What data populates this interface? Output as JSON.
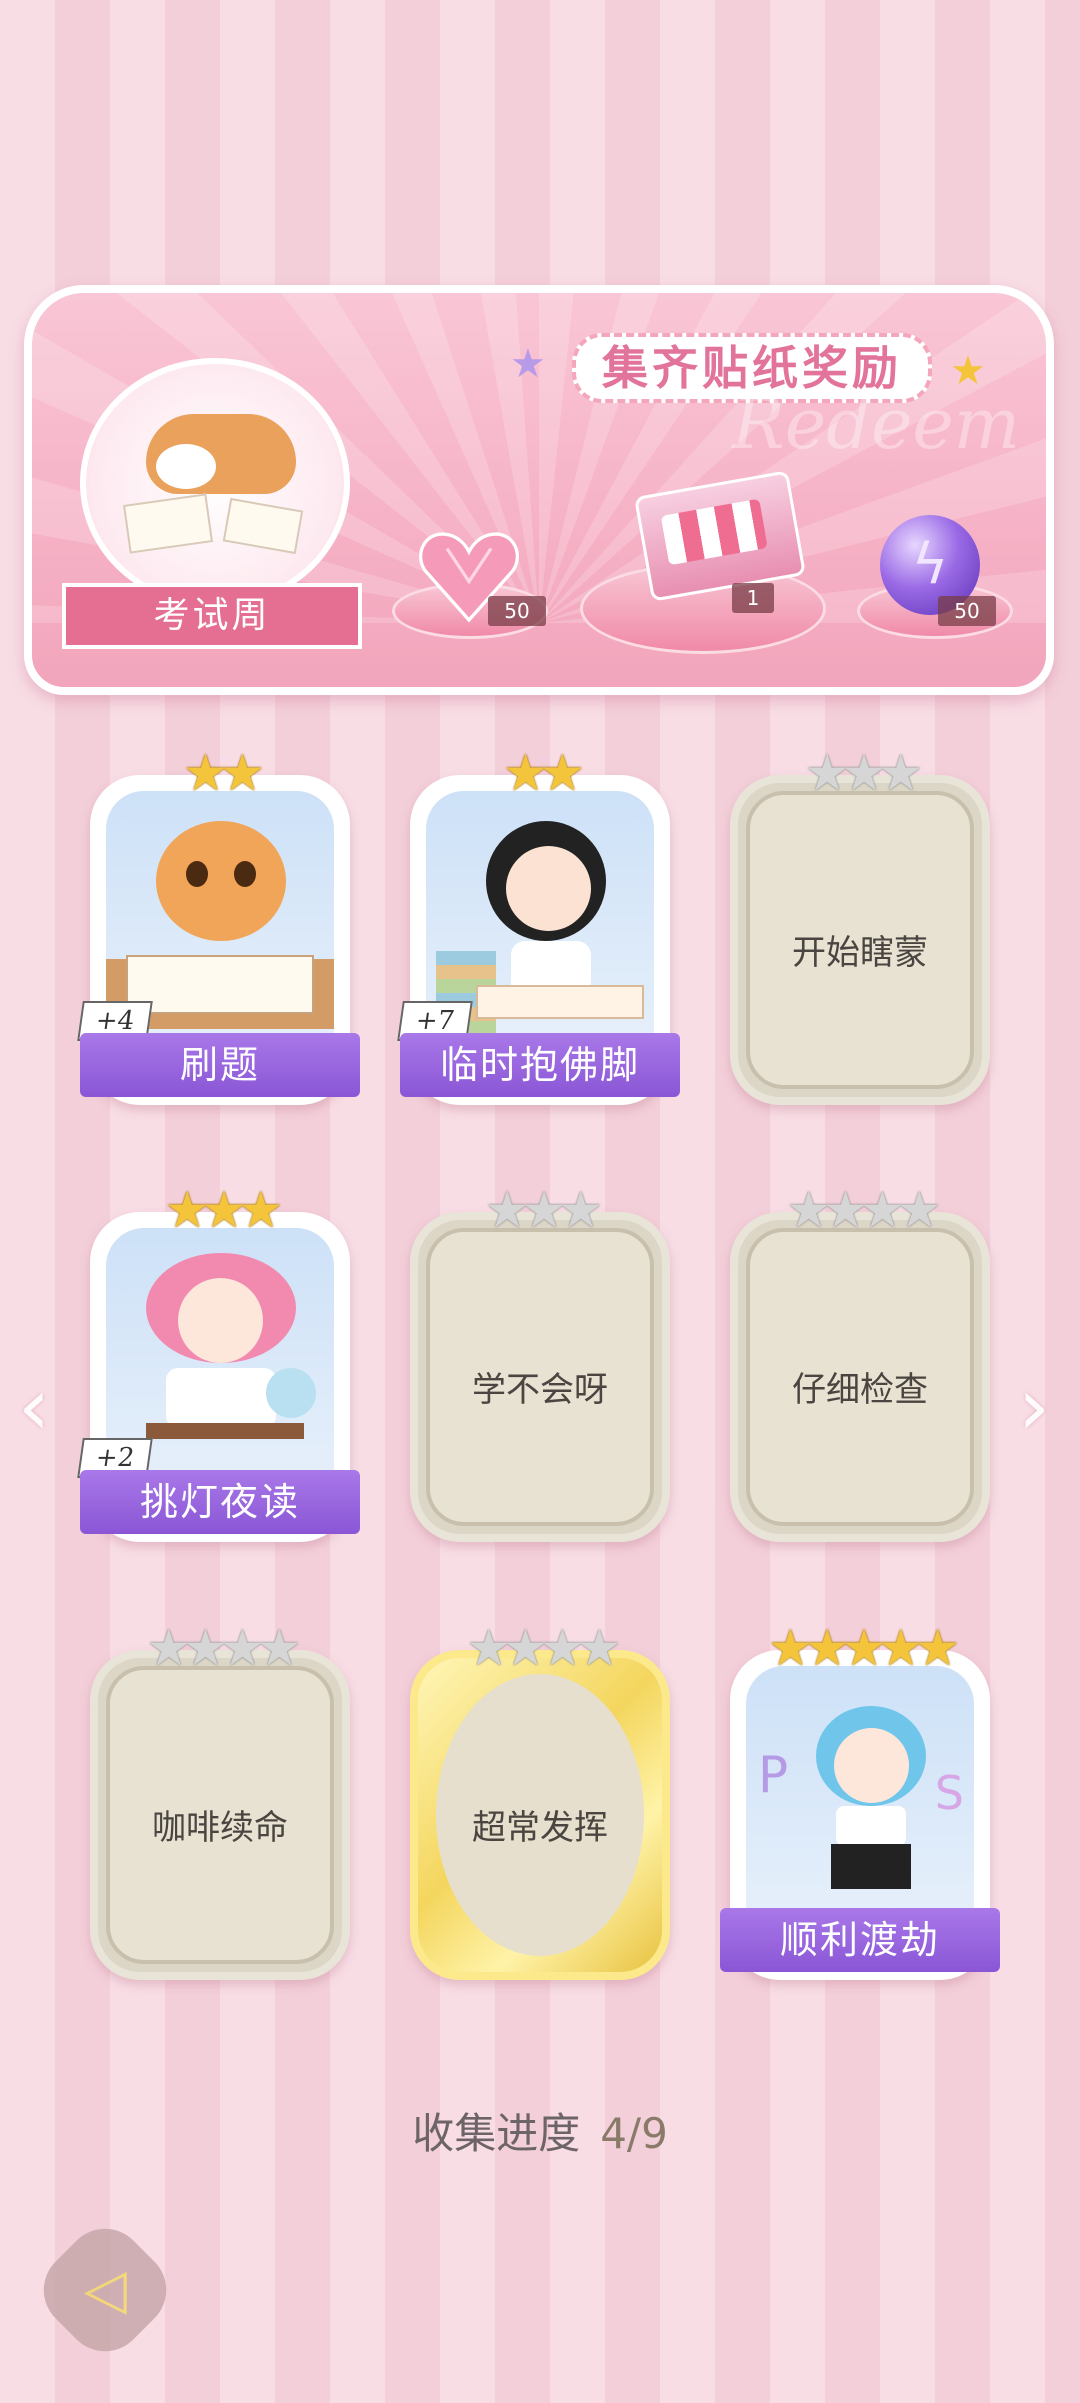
{
  "banner": {
    "title": "集齐贴纸奖励",
    "watermark": "Redeem",
    "theme_label": "考试周",
    "rewards": [
      {
        "icon": "pink-heart-gem-icon",
        "count": "50"
      },
      {
        "icon": "gift-box-icon",
        "count": "1"
      },
      {
        "icon": "purple-energy-orb-icon",
        "count": "50"
      }
    ]
  },
  "cards": [
    {
      "title": "刷题",
      "stars_filled": 2,
      "stars_total": 2,
      "unlocked": true,
      "bonus": "+4",
      "art": "cat-writing-icon"
    },
    {
      "title": "临时抱佛脚",
      "stars_filled": 2,
      "stars_total": 2,
      "unlocked": true,
      "bonus": "+7",
      "art": "girl-studying-icon"
    },
    {
      "title": "开始瞎蒙",
      "stars_filled": 0,
      "stars_total": 3,
      "unlocked": false
    },
    {
      "title": "挑灯夜读",
      "stars_filled": 3,
      "stars_total": 3,
      "unlocked": true,
      "bonus": "+2",
      "art": "girl-at-desk-icon"
    },
    {
      "title": "学不会呀",
      "stars_filled": 0,
      "stars_total": 3,
      "unlocked": false
    },
    {
      "title": "仔细检查",
      "stars_filled": 0,
      "stars_total": 4,
      "unlocked": false
    },
    {
      "title": "咖啡续命",
      "stars_filled": 0,
      "stars_total": 4,
      "unlocked": false
    },
    {
      "title": "超常发挥",
      "stars_filled": 0,
      "stars_total": 4,
      "unlocked": false,
      "frame": "gold"
    },
    {
      "title": "顺利渡劫",
      "stars_filled": 5,
      "stars_total": 5,
      "unlocked": true,
      "art": "girl-cheering-icon"
    }
  ],
  "progress": {
    "label": "收集进度",
    "value": "4/9"
  },
  "colors": {
    "label_purple": "#9a66de",
    "banner_pink": "#f6b3c7",
    "star_gold": "#f4c43a"
  }
}
